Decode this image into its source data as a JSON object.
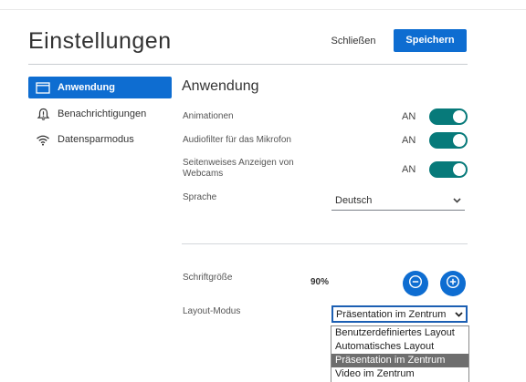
{
  "header": {
    "title": "Einstellungen",
    "close_label": "Schließen",
    "save_label": "Speichern"
  },
  "sidebar": {
    "items": [
      {
        "label": "Anwendung",
        "icon": "window-icon",
        "active": true
      },
      {
        "label": "Benachrichtigungen",
        "icon": "bell-alert-icon",
        "active": false
      },
      {
        "label": "Datensparmodus",
        "icon": "wifi-icon",
        "active": false
      }
    ]
  },
  "main": {
    "section_title": "Anwendung",
    "animations": {
      "label": "Animationen",
      "state": "AN"
    },
    "audio_filter": {
      "label": "Audiofilter für das Mikrofon",
      "state": "AN"
    },
    "pagewise_webcams": {
      "label_line1": "Seitenweises Anzeigen von",
      "label_line2": "Webcams",
      "state": "AN"
    },
    "language": {
      "label": "Sprache",
      "value": "Deutsch"
    },
    "font_size": {
      "label": "Schriftgröße",
      "value": "90%"
    },
    "layout_mode": {
      "label": "Layout-Modus",
      "value": "Präsentation im Zentrum",
      "options": [
        "Benutzerdefiniertes Layout",
        "Automatisches Layout",
        "Präsentation im Zentrum",
        "Video im Zentrum"
      ],
      "selected_index": 2
    }
  },
  "colors": {
    "accent": "#0e6dd1",
    "toggle_on": "#077a7a",
    "dropdown_selected": "#6e6e6e"
  }
}
